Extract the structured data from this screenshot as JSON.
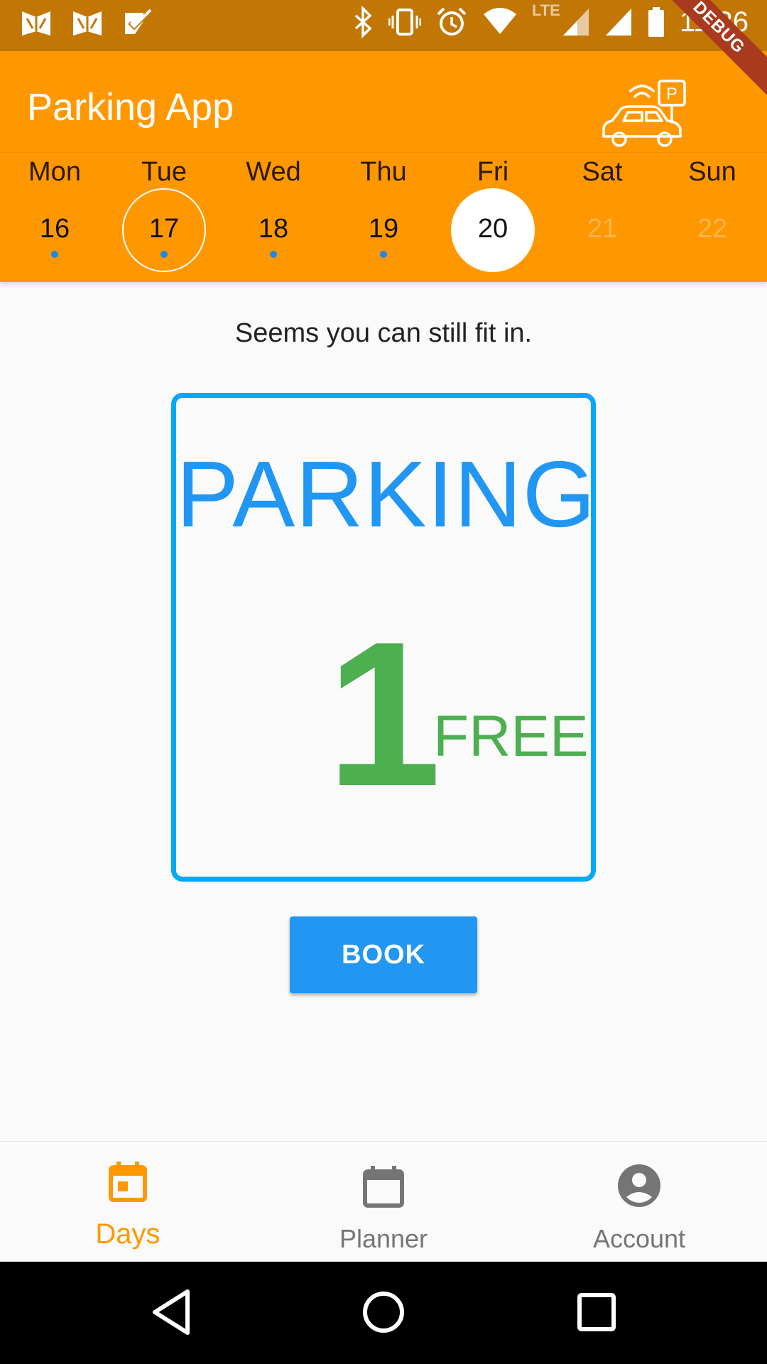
{
  "status_bar": {
    "time": "11:36",
    "network_label": "LTE",
    "icons": [
      "mail-icon",
      "mail-icon",
      "task-check-icon",
      "bluetooth-icon",
      "vibrate-icon",
      "alarm-icon",
      "wifi-icon",
      "signal-icon",
      "signal-icon",
      "battery-icon"
    ]
  },
  "debug_banner": "DEBUG",
  "app_bar": {
    "title": "Parking App",
    "logo_icon": "smart-parking-car-icon",
    "logo_letter": "P"
  },
  "week": {
    "days": [
      {
        "name": "Mon",
        "date": "16",
        "has_dot": true,
        "state": "normal"
      },
      {
        "name": "Tue",
        "date": "17",
        "has_dot": true,
        "state": "today"
      },
      {
        "name": "Wed",
        "date": "18",
        "has_dot": true,
        "state": "normal"
      },
      {
        "name": "Thu",
        "date": "19",
        "has_dot": true,
        "state": "normal"
      },
      {
        "name": "Fri",
        "date": "20",
        "has_dot": false,
        "state": "selected"
      },
      {
        "name": "Sat",
        "date": "21",
        "has_dot": false,
        "state": "disabled"
      },
      {
        "name": "Sun",
        "date": "22",
        "has_dot": false,
        "state": "disabled"
      }
    ]
  },
  "main": {
    "message": "Seems you can still fit in.",
    "card_title": "PARKING",
    "free_count": "1",
    "free_label": "FREE",
    "book_label": "BOOK"
  },
  "bottom_nav": {
    "items": [
      {
        "label": "Days",
        "icon": "calendar-today-icon",
        "active": true
      },
      {
        "label": "Planner",
        "icon": "calendar-icon",
        "active": false
      },
      {
        "label": "Account",
        "icon": "account-circle-icon",
        "active": false
      }
    ]
  },
  "colors": {
    "app_bar": "#ff9800",
    "status_bar": "#c27705",
    "accent_blue": "#2196f3",
    "card_border": "#03a9f4",
    "free_green": "#4caf50",
    "nav_active": "#ff9800",
    "nav_inactive": "#757575"
  }
}
